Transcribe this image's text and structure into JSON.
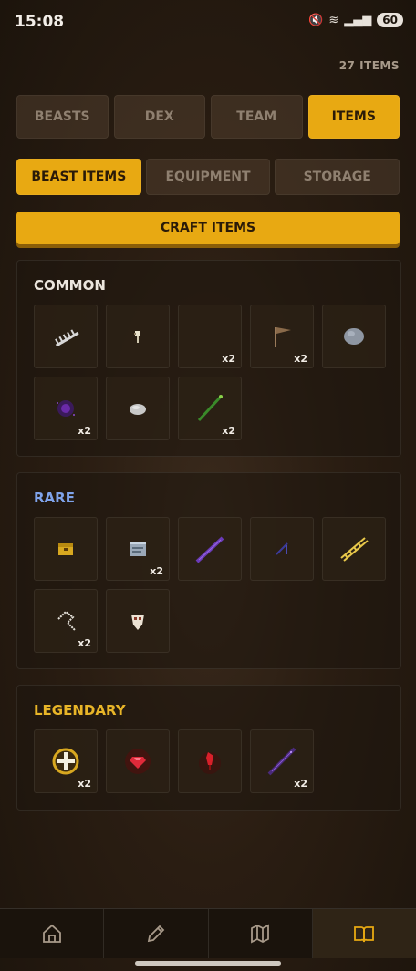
{
  "status": {
    "time": "15:08",
    "battery": "60"
  },
  "item_count": "27 ITEMS",
  "tabs": [
    {
      "label": "BEASTS"
    },
    {
      "label": "DEX"
    },
    {
      "label": "TEAM"
    },
    {
      "label": "ITEMS"
    }
  ],
  "subtabs": [
    {
      "label": "BEAST ITEMS"
    },
    {
      "label": "EQUIPMENT"
    },
    {
      "label": "STORAGE"
    }
  ],
  "craft_label": "CRAFT ITEMS",
  "sections": {
    "common": {
      "title": "COMMON",
      "items": [
        {
          "icon": "bone-rail-icon",
          "qty": ""
        },
        {
          "icon": "small-bone-icon",
          "qty": ""
        },
        {
          "icon": "empty-icon",
          "qty": "x2"
        },
        {
          "icon": "wooden-flag-icon",
          "qty": "x2"
        },
        {
          "icon": "grey-stone-icon",
          "qty": ""
        },
        {
          "icon": "dark-orb-icon",
          "qty": "x2"
        },
        {
          "icon": "pebble-icon",
          "qty": ""
        },
        {
          "icon": "green-wand-icon",
          "qty": "x2"
        }
      ]
    },
    "rare": {
      "title": "RARE",
      "items": [
        {
          "icon": "gold-chest-icon",
          "qty": ""
        },
        {
          "icon": "scroll-icon",
          "qty": "x2"
        },
        {
          "icon": "purple-sword-icon",
          "qty": ""
        },
        {
          "icon": "small-blade-icon",
          "qty": ""
        },
        {
          "icon": "gold-ladder-icon",
          "qty": ""
        },
        {
          "icon": "bone-whip-icon",
          "qty": "x2"
        },
        {
          "icon": "skull-icon",
          "qty": ""
        }
      ]
    },
    "legendary": {
      "title": "LEGENDARY",
      "items": [
        {
          "icon": "holy-shield-icon",
          "qty": "x2"
        },
        {
          "icon": "red-gem-icon",
          "qty": ""
        },
        {
          "icon": "blood-crystal-icon",
          "qty": ""
        },
        {
          "icon": "void-blade-icon",
          "qty": "x2"
        }
      ]
    }
  },
  "bottom_nav": [
    {
      "icon": "home-icon"
    },
    {
      "icon": "pencil-icon"
    },
    {
      "icon": "map-icon"
    },
    {
      "icon": "book-icon"
    }
  ]
}
